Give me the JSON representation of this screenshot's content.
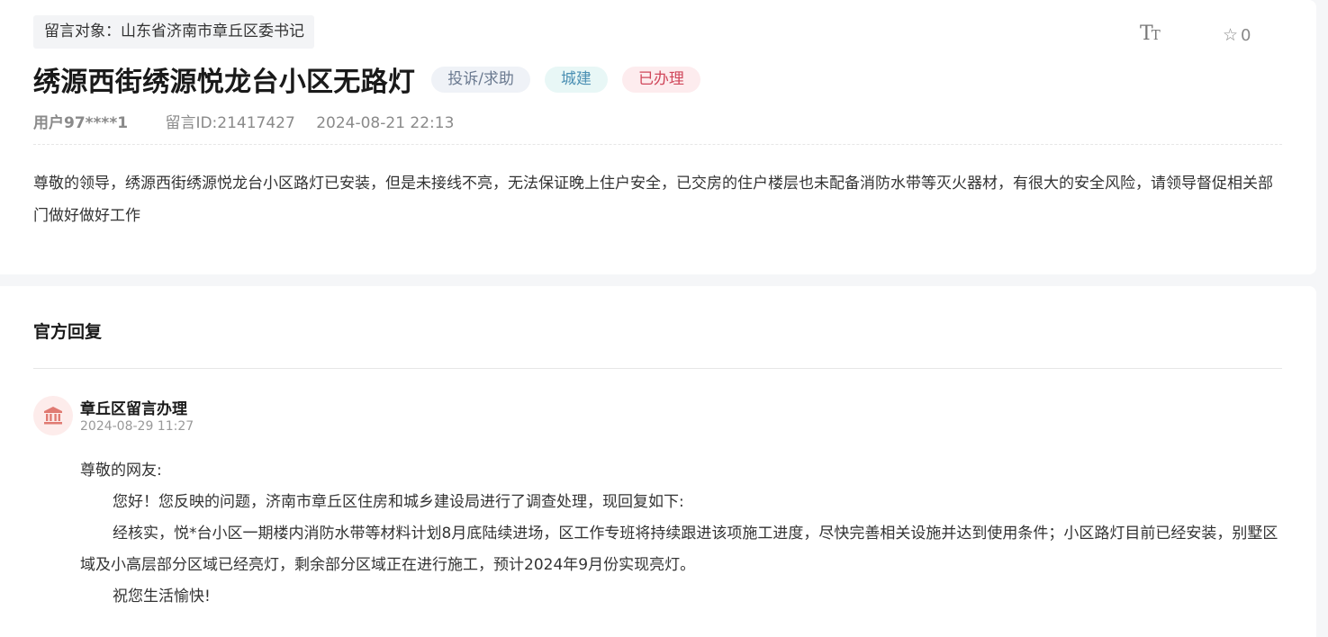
{
  "message": {
    "target": "留言对象：山东省济南市章丘区委书记",
    "title": "绣源西街绣源悦龙台小区无路灯",
    "tags": {
      "type": "投诉/求助",
      "category": "城建",
      "status": "已办理"
    },
    "user": "用户97****1",
    "message_id": "留言ID:21417427",
    "datetime": "2024-08-21 22:13",
    "body": "尊敬的领导，绣源西街绣源悦龙台小区路灯已安装，但是未接线不亮，无法保证晚上住户安全，已交房的住户楼层也未配备消防水带等灭火器材，有很大的安全风险，请领导督促相关部门做好做好工作"
  },
  "toolbar": {
    "font_size_icon_text": "T",
    "font_size_icon_small": "T",
    "favorite_count": "0"
  },
  "reply": {
    "heading": "官方回复",
    "department": "章丘区留言办理",
    "datetime": "2024-08-29 11:27",
    "greeting": "尊敬的网友:",
    "paragraphs": [
      "您好！您反映的问题，济南市章丘区住房和城乡建设局进行了调查处理，现回复如下:",
      "经核实，悦*台小区一期楼内消防水带等材料计划8月底陆续进场，区工作专班将持续跟进该项施工进度，尽快完善相关设施并达到使用条件；小区路灯目前已经安装，别墅区域及小高层部分区域已经亮灯，剩余部分区域正在进行施工，预计2024年9月份实现亮灯。",
      "祝您生活愉快!"
    ]
  },
  "icons": {
    "font_size": "font-size-icon",
    "favorite": "star-outline-icon",
    "department_avatar": "government-building-icon"
  },
  "colors": {
    "tag_type_bg": "#eff2f7",
    "tag_category_bg": "#e8f7f6",
    "tag_status_bg": "#fdecee",
    "tag_status_text": "#d0475b",
    "avatar_bg": "#fdeceb",
    "avatar_icon": "#e07a72"
  }
}
